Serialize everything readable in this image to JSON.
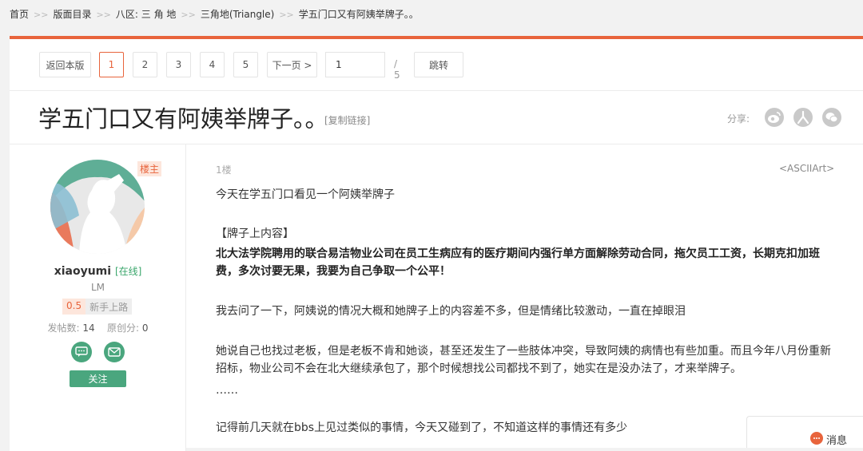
{
  "breadcrumb": {
    "items": [
      "首页",
      "版面目录",
      "八区: 三 角 地",
      "三角地(Triangle)",
      "学五门口又有阿姨举牌子。。"
    ],
    "separator": ">>"
  },
  "pager": {
    "back_label": "返回本版",
    "pages": [
      "1",
      "2",
      "3",
      "4",
      "5"
    ],
    "current_page": "1",
    "next_label": "下一页 >",
    "input_value": "1",
    "total": "/ 5",
    "jump_label": "跳转"
  },
  "thread": {
    "title": "学五门口又有阿姨举牌子。。",
    "copy_link": "[复制链接]",
    "share_label": "分享:",
    "share_icons": [
      "weibo-icon",
      "renren-icon",
      "wechat-icon"
    ]
  },
  "author": {
    "badge": "楼主",
    "name": "xiaoyumi",
    "status": "[在线]",
    "title": "LM",
    "level_num": "0.5",
    "level_name": "新手上路",
    "stats": {
      "posts_label": "发帖数:",
      "posts": "14",
      "original_label": "原创分:",
      "original": "0"
    },
    "follow_label": "关注"
  },
  "post": {
    "floor": "1楼",
    "tag": "<ASCIIArt>",
    "paragraphs": [
      "今天在学五门口看见一个阿姨举牌子",
      "【牌子上内容】",
      "北大法学院聘用的联合易洁物业公司在员工生病应有的医疗期间内强行单方面解除劳动合同，拖欠员工工资，长期克扣加班费，多次讨要无果，我要为自己争取一个公平！",
      "我去问了一下，阿姨说的情况大概和她牌子上的内容差不多，但是情绪比较激动，一直在掉眼泪",
      "她说自己也找过老板，但是老板不肯和她谈，甚至还发生了一些肢体冲突，导致阿姨的病情也有些加重。而且今年八月份重新招标，物业公司不会在北大继续承包了，那个时候想找公司都找不到了，她实在是没办法了，才来举牌子。",
      "……",
      "记得前几天就在bbs上见过类似的事情，今天又碰到了，不知道这样的事情还有多少"
    ]
  },
  "messages": {
    "label": "消息"
  },
  "colors": {
    "accent": "#e8643c",
    "green": "#4aa67e"
  }
}
